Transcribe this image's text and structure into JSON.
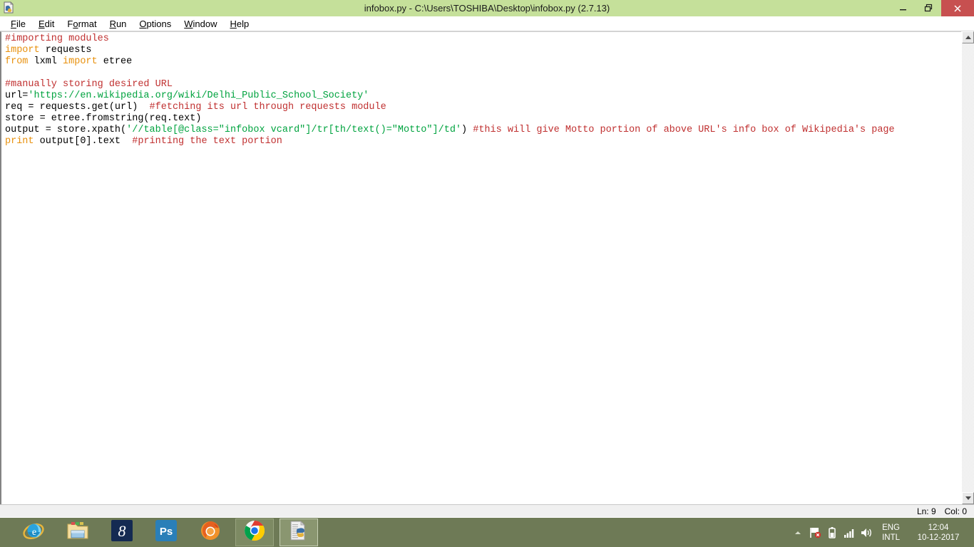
{
  "window": {
    "title": "infobox.py - C:\\Users\\TOSHIBA\\Desktop\\infobox.py (2.7.13)",
    "icon": "python-file-icon",
    "minimize_label": "Minimize",
    "restore_label": "Restore",
    "close_label": "Close",
    "titlebar_color": "#c5e09a",
    "close_color": "#c75050"
  },
  "menubar": {
    "items": [
      {
        "label": "File",
        "accel": "F"
      },
      {
        "label": "Edit",
        "accel": "E"
      },
      {
        "label": "Format",
        "accel": "o"
      },
      {
        "label": "Run",
        "accel": "R"
      },
      {
        "label": "Options",
        "accel": "O"
      },
      {
        "label": "Window",
        "accel": "W"
      },
      {
        "label": "Help",
        "accel": "H"
      }
    ]
  },
  "editor": {
    "colors": {
      "comment": "#c03030",
      "keyword": "#e8900c",
      "string": "#00a33f",
      "plain": "#000000",
      "background": "#ffffff"
    },
    "lines": [
      [
        {
          "t": "#importing modules",
          "c": "cm"
        }
      ],
      [
        {
          "t": "import",
          "c": "kw"
        },
        {
          "t": " requests",
          "c": "pl"
        }
      ],
      [
        {
          "t": "from",
          "c": "kw"
        },
        {
          "t": " lxml ",
          "c": "pl"
        },
        {
          "t": "import",
          "c": "kw"
        },
        {
          "t": " etree",
          "c": "pl"
        }
      ],
      [
        {
          "t": "",
          "c": "pl"
        }
      ],
      [
        {
          "t": "#manually storing desired URL",
          "c": "cm"
        }
      ],
      [
        {
          "t": "url=",
          "c": "pl"
        },
        {
          "t": "'https://en.wikipedia.org/wiki/Delhi_Public_School_Society'",
          "c": "st"
        }
      ],
      [
        {
          "t": "req = requests.get(url)  ",
          "c": "pl"
        },
        {
          "t": "#fetching its url through requests module",
          "c": "cm"
        }
      ],
      [
        {
          "t": "store = etree.fromstring(req.text)",
          "c": "pl"
        }
      ],
      [
        {
          "t": "output = store.xpath(",
          "c": "pl"
        },
        {
          "t": "'//table[@class=\"infobox vcard\"]/tr[th/text()=\"Motto\"]/td'",
          "c": "st"
        },
        {
          "t": ") ",
          "c": "pl"
        },
        {
          "t": "#this will give Motto portion of above URL's info box of Wikipedia's page",
          "c": "cm"
        }
      ],
      [
        {
          "t": "print",
          "c": "kw"
        },
        {
          "t": " output[0].text  ",
          "c": "pl"
        },
        {
          "t": "#printing the text portion",
          "c": "cm"
        }
      ]
    ]
  },
  "scrollbar": {
    "up_label": "Scroll up",
    "down_label": "Scroll down"
  },
  "statusbar": {
    "line": "Ln: 9",
    "col": "Col: 0"
  },
  "taskbar": {
    "background": "#6e7a56",
    "items": [
      {
        "name": "internet-explorer-icon",
        "label": "Internet Explorer",
        "state": "idle"
      },
      {
        "name": "file-explorer-icon",
        "label": "File Explorer",
        "state": "idle"
      },
      {
        "name": "eight-app-icon",
        "label": "8",
        "state": "idle"
      },
      {
        "name": "photoshop-icon",
        "label": "Ps",
        "state": "idle"
      },
      {
        "name": "firefox-icon",
        "label": "Mozilla Firefox",
        "state": "idle"
      },
      {
        "name": "chrome-icon",
        "label": "Google Chrome",
        "state": "running"
      },
      {
        "name": "python-idle-icon",
        "label": "IDLE (Python GUI)",
        "state": "active"
      }
    ],
    "tray": {
      "show_hidden_label": "Show hidden icons",
      "icons": [
        {
          "name": "action-center-flag-icon",
          "label": "Action Center"
        },
        {
          "name": "battery-icon",
          "label": "Battery"
        },
        {
          "name": "network-signal-icon",
          "label": "Network"
        },
        {
          "name": "volume-speaker-icon",
          "label": "Volume"
        }
      ],
      "language_line1": "ENG",
      "language_line2": "INTL",
      "time": "12:04",
      "date": "10-12-2017"
    }
  }
}
